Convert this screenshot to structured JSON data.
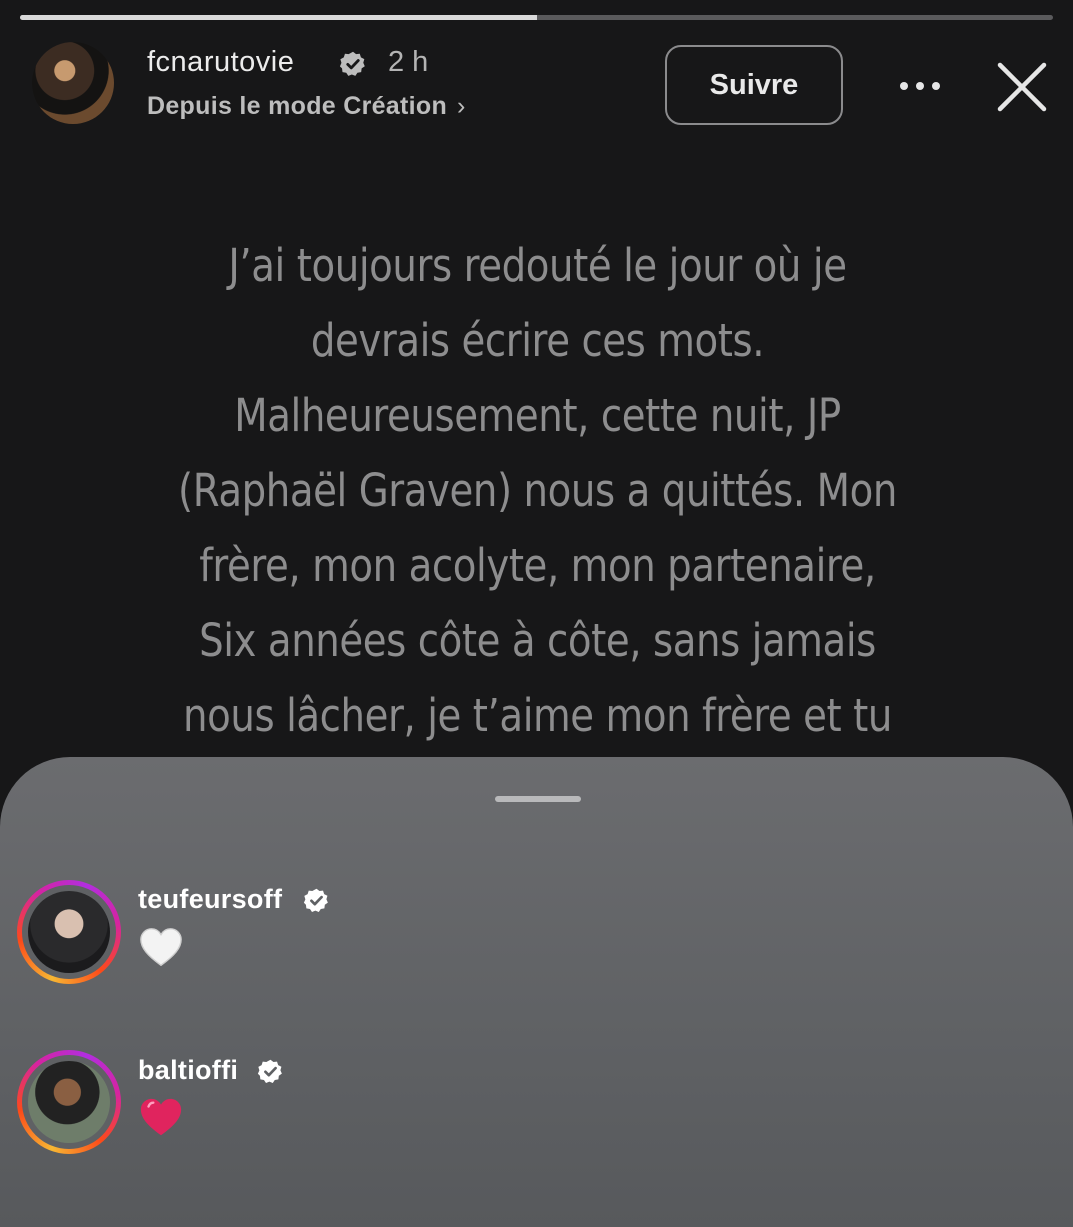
{
  "progress": 0.5,
  "header": {
    "username": "fcnarutovie",
    "time": "2 h",
    "subtitle": "Depuis le mode Création",
    "follow_label": "Suivre",
    "more_icon": "more-horizontal-icon",
    "close_icon": "close-icon",
    "verified_icon": "verified-badge-icon"
  },
  "story": {
    "lines": [
      "J’ai toujours redouté le jour où je",
      "devrais écrire ces mots.",
      "Malheureusement, cette nuit, JP",
      "(Raphaël Graven) nous a quittés. Mon",
      "frère, mon acolyte, mon partenaire,",
      "Six années côte à côte, sans jamais",
      "nous lâcher, je t’aime mon frère et tu"
    ]
  },
  "reactions": [
    {
      "username": "teufeursoff",
      "emoji": "🤍",
      "emoji_icon": "white-heart-icon",
      "verified": true
    },
    {
      "username": "baltioffi",
      "emoji": "❤️",
      "emoji_icon": "red-heart-icon",
      "verified": true
    }
  ],
  "colors": {
    "background": "#171718",
    "sheet": "#5f6164",
    "story_text": "#8d8d8e",
    "red_heart": "#e0245e"
  }
}
